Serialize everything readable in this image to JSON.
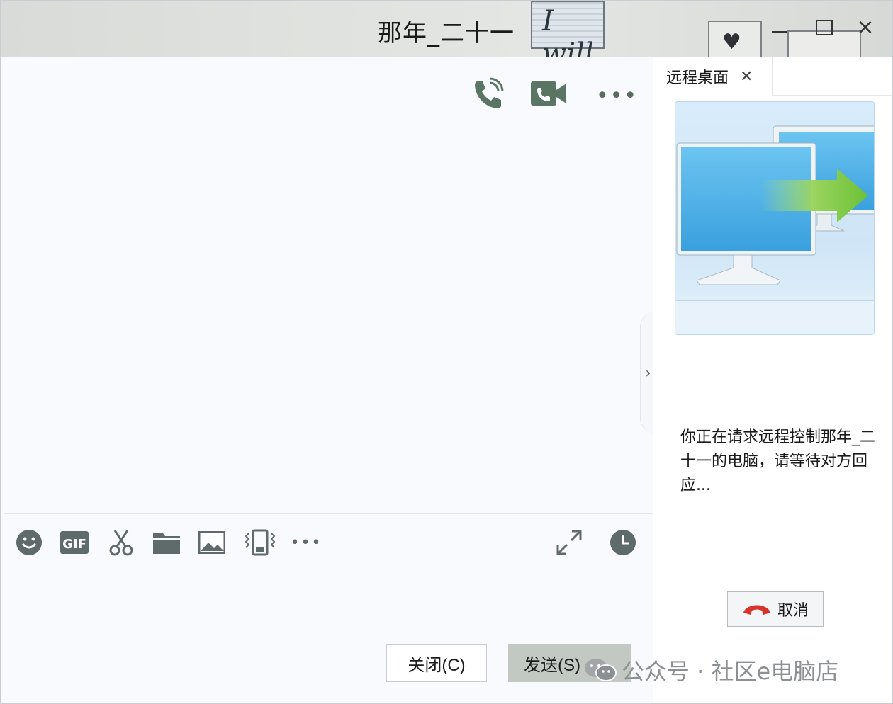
{
  "window": {
    "title": "那年_二十一",
    "banner_text": "I will"
  },
  "chat": {
    "toolbar_icons": [
      "phone-icon",
      "video-call-icon",
      "more-icon"
    ],
    "more_label": "•••"
  },
  "input": {
    "tools": [
      "emoji-icon",
      "gif-icon",
      "scissors-icon",
      "folder-icon",
      "image-icon",
      "shake-icon",
      "more-icon",
      "expand-icon",
      "history-clock-icon"
    ],
    "more_label": "•••",
    "close_button": "关闭(C)",
    "send_button": "发送(S)"
  },
  "panel": {
    "tab_label": "远程桌面",
    "status": "你正在请求远程控制那年_二十一的电脑，请等待对方回应...",
    "cancel_button": "取消"
  },
  "watermark": "公众号 · 社区e电脑店",
  "colors": {
    "accent_green": "#5a7563",
    "hangup_red": "#d9322b"
  }
}
